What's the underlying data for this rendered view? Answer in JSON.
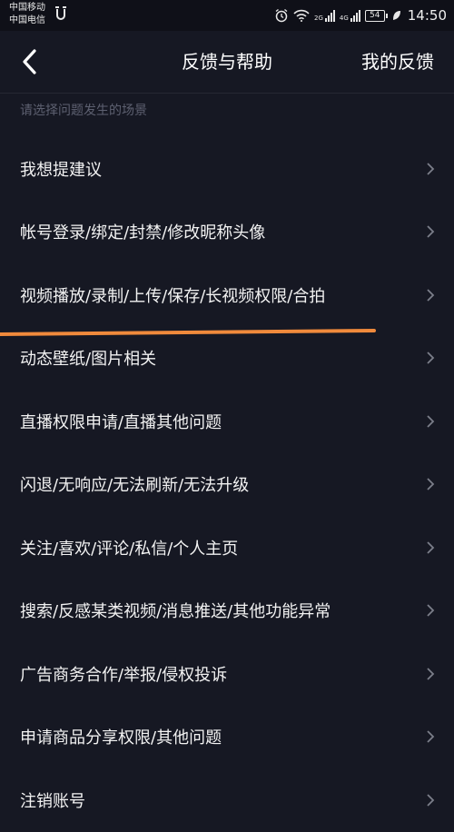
{
  "status_bar": {
    "carrier_1": "中国移动",
    "carrier_2": "中国电信",
    "sim1_network": "2G",
    "sim2_network": "4G",
    "battery": "54",
    "time": "14:50"
  },
  "nav": {
    "title": "反馈与帮助",
    "right_action": "我的反馈"
  },
  "section_hint": "请选择问题发生的场景",
  "issues": [
    {
      "label": "我想提建议"
    },
    {
      "label": "帐号登录/绑定/封禁/修改昵称头像"
    },
    {
      "label": "视频播放/录制/上传/保存/长视频权限/合拍"
    },
    {
      "label": "动态壁纸/图片相关"
    },
    {
      "label": "直播权限申请/直播其他问题"
    },
    {
      "label": "闪退/无响应/无法刷新/无法升级"
    },
    {
      "label": "关注/喜欢/评论/私信/个人主页"
    },
    {
      "label": "搜索/反感某类视频/消息推送/其他功能异常"
    },
    {
      "label": "广告商务合作/举报/侵权投诉"
    },
    {
      "label": "申请商品分享权限/其他问题"
    },
    {
      "label": "注销账号"
    }
  ],
  "colors": {
    "background": "#161823",
    "hint_text": "#5d6070",
    "chevron": "#7b7e8a",
    "annotation": "#f08a3c"
  }
}
